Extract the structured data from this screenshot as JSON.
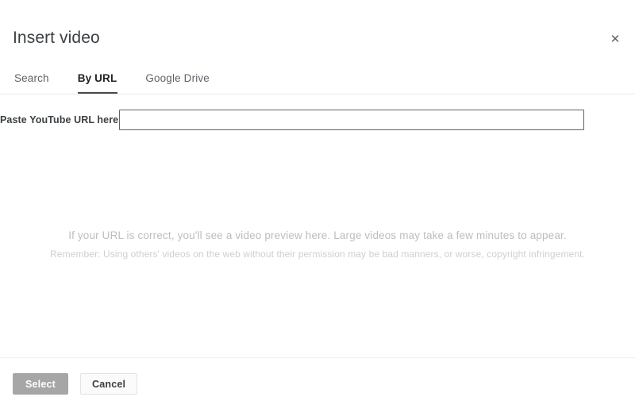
{
  "dialog": {
    "title": "Insert video",
    "close_icon": "close-icon",
    "close_glyph": "✕"
  },
  "tabs": [
    {
      "label": "Search",
      "active": false
    },
    {
      "label": "By URL",
      "active": true
    },
    {
      "label": "Google Drive",
      "active": false
    }
  ],
  "form": {
    "url_label": "Paste YouTube URL here:",
    "url_value": "",
    "url_placeholder": ""
  },
  "preview": {
    "hint_primary": "If your URL is correct, you'll see a video preview here. Large videos may take a few minutes to appear.",
    "hint_secondary": "Remember: Using others' videos on the web without their permission may be bad manners, or worse, copyright infringement."
  },
  "footer": {
    "select_label": "Select",
    "cancel_label": "Cancel"
  },
  "colors": {
    "accent_active_tab": "#4a4a4a",
    "title_text": "#3c4043",
    "muted_text": "#5f6368",
    "hint_text": "#bdbdbd",
    "select_disabled_bg": "#a6a6a6",
    "input_border": "#646464"
  }
}
